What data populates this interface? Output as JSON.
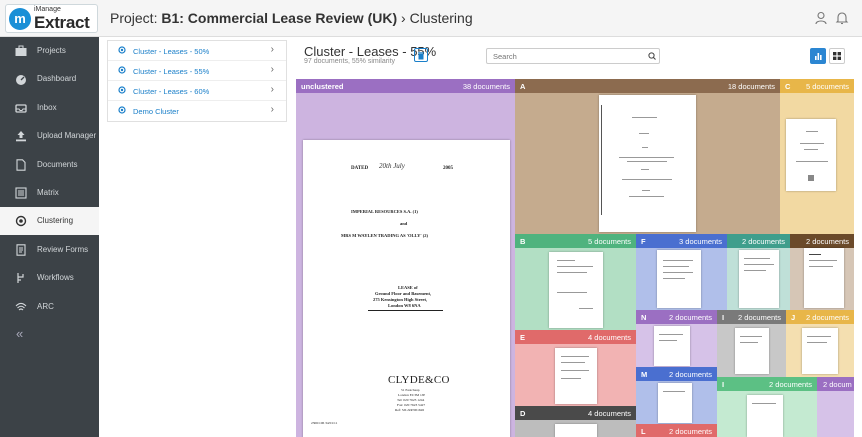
{
  "header": {
    "logo_small": "iManage",
    "logo_big": "Extract",
    "logo_letter": "m",
    "breadcrumb_prefix": "Project: ",
    "breadcrumb_project": "B1: Commercial Lease Review (UK)",
    "breadcrumb_sep": " › ",
    "breadcrumb_page": "Clustering",
    "icons": [
      "user-icon",
      "bell-icon"
    ]
  },
  "sidebar": {
    "items": [
      {
        "label": "Projects",
        "icon": "briefcase-icon"
      },
      {
        "label": "Dashboard",
        "icon": "dashboard-icon"
      },
      {
        "label": "Inbox",
        "icon": "inbox-icon"
      },
      {
        "label": "Upload Manager",
        "icon": "upload-icon"
      },
      {
        "label": "Documents",
        "icon": "document-icon"
      },
      {
        "label": "Matrix",
        "icon": "matrix-icon"
      },
      {
        "label": "Clustering",
        "icon": "clustering-icon",
        "active": true
      },
      {
        "label": "Review Forms",
        "icon": "form-icon"
      },
      {
        "label": "Workflows",
        "icon": "workflow-icon"
      },
      {
        "label": "ARC",
        "icon": "arc-icon"
      }
    ],
    "collapse_glyph": "«"
  },
  "cluster_list": [
    {
      "label": "Cluster - Leases - 50%"
    },
    {
      "label": "Cluster - Leases - 55%"
    },
    {
      "label": "Cluster - Leases - 60%"
    },
    {
      "label": "Demo Cluster"
    }
  ],
  "main": {
    "title": "Cluster - Leases - 55%",
    "subtitle": "97 documents, 55% similarity",
    "search_placeholder": "Search"
  },
  "colors": {
    "sidebar_bg": "#3c4247",
    "accent": "#2b86d2",
    "unclustered": "#9b6fc2",
    "A": "#8c6b4f",
    "B": "#4fb37e",
    "C": "#e8b649",
    "D": "#4a4a4a",
    "E": "#e06a6a",
    "F": "#4a6fd0"
  },
  "tiles": {
    "unclustered": {
      "name": "unclustered",
      "count": "38 documents"
    },
    "A": {
      "name": "A",
      "count": "18 documents"
    },
    "C": {
      "name": "C",
      "count": "5 documents"
    },
    "B": {
      "name": "B",
      "count": "5 documents"
    },
    "F": {
      "name": "F",
      "count": "3 documents"
    },
    "F2": {
      "name": "",
      "count": "2 documents"
    },
    "F3": {
      "name": "",
      "count": "2 documents"
    },
    "N": {
      "name": "N",
      "count": "2 documents"
    },
    "I": {
      "name": "I",
      "count": "2 documents"
    },
    "J": {
      "name": "J",
      "count": "2 documents"
    },
    "E": {
      "name": "E",
      "count": "4 documents"
    },
    "M": {
      "name": "M",
      "count": "2 documents"
    },
    "I2": {
      "name": "I",
      "count": "2 documents"
    },
    "I3": {
      "name": "",
      "count": "2 docum"
    },
    "D": {
      "name": "D",
      "count": "4 documents"
    },
    "L": {
      "name": "L",
      "count": "2 documents"
    }
  },
  "lease_doc": {
    "dated_label": "DATED",
    "dated_hand": "20th July",
    "dated_year": "2005",
    "party1": "IMPERIAL RESOURCES S.A. (1)",
    "and": "and",
    "party2": "MRS M WAYLEN TRADING AS 'OLLY' (2)",
    "lease_title": "LEASE of",
    "lease_line1": "Ground Floor and Basement,",
    "lease_line2": "275 Kensington High Street,",
    "lease_line3": "London W8 6NA",
    "firm": "CLYDE&CO",
    "firm_line1": "51 Eastcheap",
    "firm_line2": "London EC3M 1JP",
    "firm_line3": "Tel: 020 7623 1244",
    "firm_line4": "Fax: 020 7623 5427",
    "firm_line5": "Ref: SJL/RP/001626",
    "footer_ref": "2306/106 34/01/11"
  }
}
